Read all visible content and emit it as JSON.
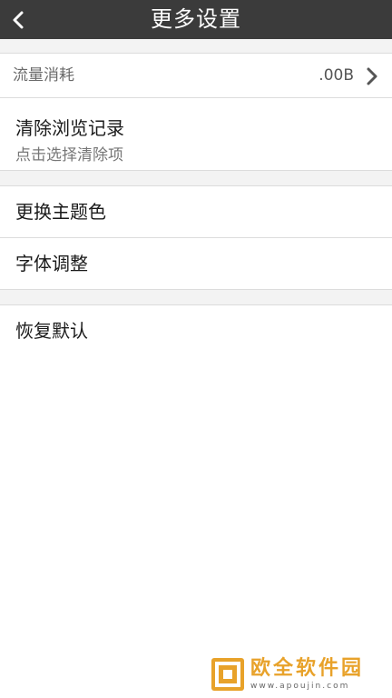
{
  "header": {
    "title": "更多设置"
  },
  "traffic": {
    "label": "流量消耗",
    "value": ".00B"
  },
  "clear_history": {
    "label": "清除浏览记录",
    "sub": "点击选择清除项"
  },
  "theme": {
    "label": "更换主题色"
  },
  "font": {
    "label": "字体调整"
  },
  "reset": {
    "label": "恢复默认"
  },
  "watermark": {
    "title": "欧全软件园",
    "url": "www.apoujin.com"
  },
  "colors": {
    "topbar": "#3b3b3b",
    "background": "#f3f3f3",
    "watermark": "#e8a22a"
  }
}
